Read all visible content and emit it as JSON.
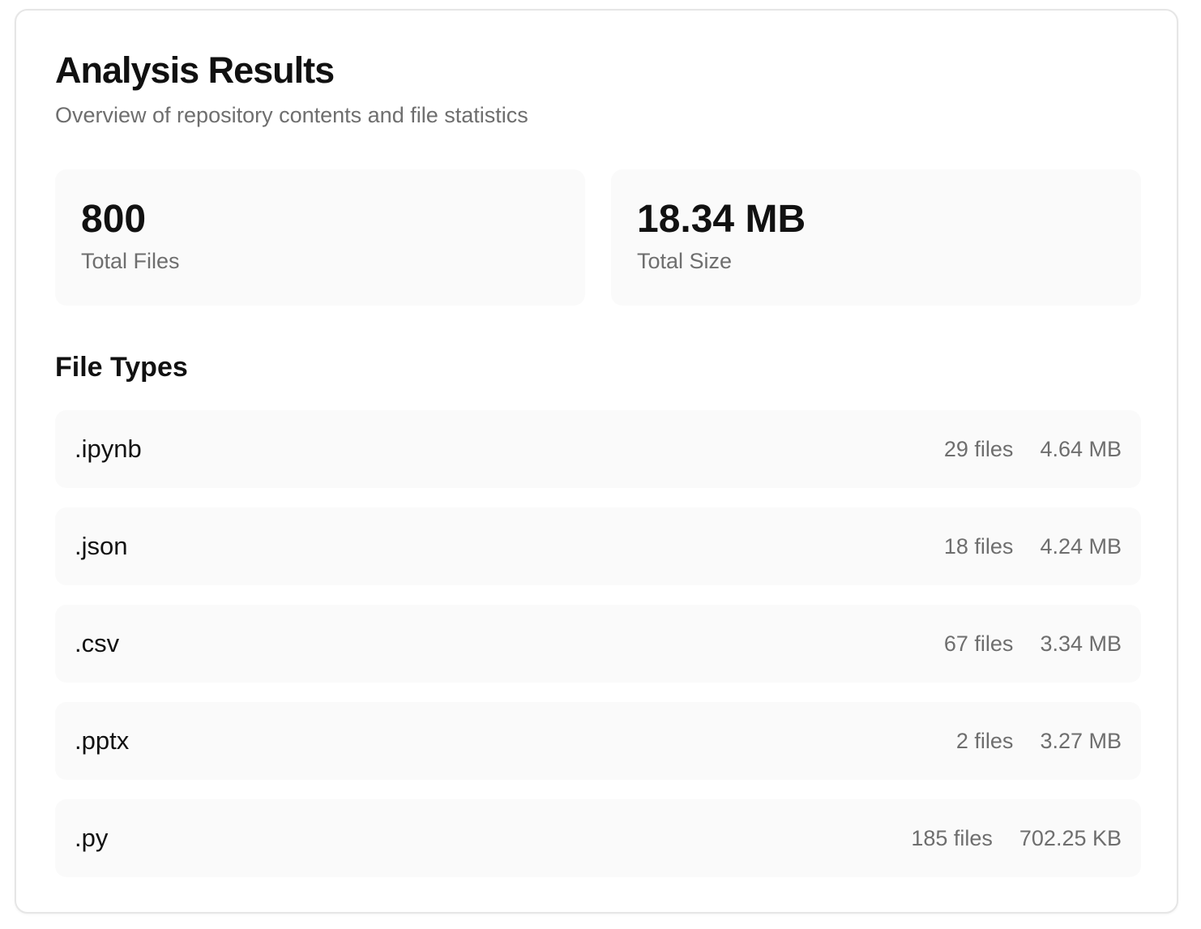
{
  "header": {
    "title": "Analysis Results",
    "subtitle": "Overview of repository contents and file statistics"
  },
  "stats": {
    "total_files": {
      "value": "800",
      "label": "Total Files"
    },
    "total_size": {
      "value": "18.34 MB",
      "label": "Total Size"
    }
  },
  "file_types": {
    "title": "File Types",
    "items": [
      {
        "ext": ".ipynb",
        "count": "29 files",
        "size": "4.64 MB"
      },
      {
        "ext": ".json",
        "count": "18 files",
        "size": "4.24 MB"
      },
      {
        "ext": ".csv",
        "count": "67 files",
        "size": "3.34 MB"
      },
      {
        "ext": ".pptx",
        "count": "2 files",
        "size": "3.27 MB"
      },
      {
        "ext": ".py",
        "count": "185 files",
        "size": "702.25 KB"
      }
    ]
  }
}
